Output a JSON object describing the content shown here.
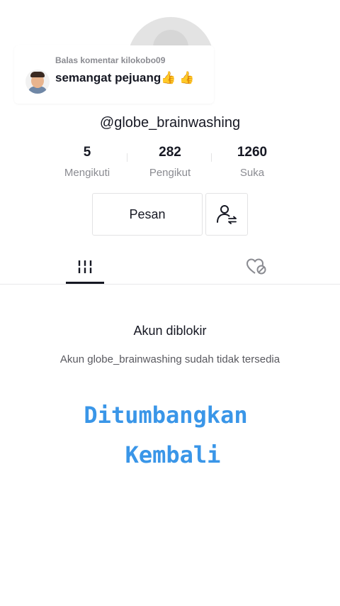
{
  "profile": {
    "username": "@globe_brainwashing"
  },
  "reply_card": {
    "label": "Balas komentar kilokobo09",
    "comment": "semangat pejuang👍 👍"
  },
  "stats": [
    {
      "value": "5",
      "label": "Mengikuti"
    },
    {
      "value": "282",
      "label": "Pengikut"
    },
    {
      "value": "1260",
      "label": "Suka"
    }
  ],
  "actions": {
    "message_label": "Pesan",
    "friend_icon": "add-friend-icon"
  },
  "tabs": {
    "videos_icon": "grid-icon",
    "liked_icon": "hidden-heart-icon",
    "active": "videos"
  },
  "blocked": {
    "title": "Akun diblokir",
    "description": "Akun globe_brainwashing sudah tidak tersedia"
  },
  "overlay": {
    "line1": "Ditumbangkan",
    "line2": "Kembali",
    "color": "#3a96e8"
  }
}
